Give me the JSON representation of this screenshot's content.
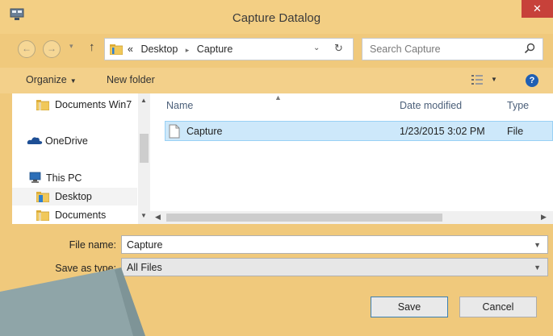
{
  "window": {
    "title": "Capture Datalog",
    "close_glyph": "✕"
  },
  "address": {
    "back_glyph": "←",
    "forward_glyph": "→",
    "down_glyph": "▾",
    "up_glyph": "↑",
    "prefix": "«",
    "crumbs": [
      "Desktop",
      "Capture"
    ],
    "separator": "▸",
    "dropdown_glyph": "⌄",
    "refresh_glyph": "↻"
  },
  "search": {
    "placeholder": "Search Capture"
  },
  "toolbar": {
    "organize_label": "Organize",
    "new_folder_label": "New folder",
    "help_glyph": "?"
  },
  "nav_pane": {
    "items": [
      {
        "label": "Documents Win7",
        "icon": "folder-icon"
      },
      {
        "label": "OneDrive",
        "icon": "cloud-icon"
      },
      {
        "label": "This PC",
        "icon": "computer-icon"
      },
      {
        "label": "Desktop",
        "icon": "desktop-folder-icon"
      },
      {
        "label": "Documents",
        "icon": "folder-icon"
      }
    ]
  },
  "file_list": {
    "columns": [
      "Name",
      "Date modified",
      "Type"
    ],
    "rows": [
      {
        "name": "Capture",
        "date_modified": "1/23/2015 3:02 PM",
        "type": "File"
      }
    ]
  },
  "form": {
    "file_name_label": "File name:",
    "file_name_value": "Capture",
    "save_as_type_label": "Save as type:",
    "save_as_type_value": "All Files"
  },
  "buttons": {
    "save": "Save",
    "cancel": "Cancel"
  },
  "colors": {
    "frame": "#f0c97c",
    "close": "#c7413a",
    "selection": "#cde8fa",
    "overlay_card": "#8fa5a8"
  }
}
